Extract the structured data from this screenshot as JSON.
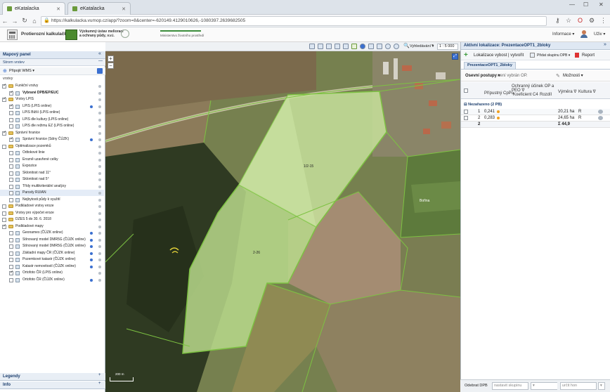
{
  "browser": {
    "tabs": [
      {
        "label": "eKatalacka",
        "active": true
      },
      {
        "label": "eKatalacka",
        "active": false
      }
    ],
    "url": "https://kalkulacka.vumop.cz/app/?zoom=8&center=-620149.4129010626,-1080397.2639682505"
  },
  "header": {
    "app_name": "Protierozní kalkulačka",
    "institute_name_line1": "Výzkumný ústav meliorací",
    "institute_name_line2": "a ochrany půdy, v.v.i.",
    "ministry": "Ministerstvo životního prostředí",
    "user_menu": "Informace ▾",
    "user_name": "Uživ ▾"
  },
  "map_toolbar": {
    "search_label": "Vyhledávání ▾",
    "scale": "1 : 5 000"
  },
  "left_panel": {
    "title": "Mapový panel",
    "subtitle": "Strom vrstev",
    "add_wms": "Připojit WMS ▾",
    "tree_label": "vrstvy",
    "layers": [
      {
        "label": "Funkční vrstvy",
        "type": "folder",
        "checked": true,
        "indent": 0
      },
      {
        "label": "Vybrané DPB/EP/EUC",
        "type": "layer",
        "checked": true,
        "indent": 1,
        "bold": true
      },
      {
        "label": "Vrstvy LPIS",
        "type": "folder",
        "checked": true,
        "indent": 0
      },
      {
        "label": "LPIS (LPIS online)",
        "type": "layer",
        "checked": true,
        "indent": 1,
        "dot": "#3a6fd0"
      },
      {
        "label": "LPIS Bižší (LPIS online)",
        "type": "layer",
        "checked": false,
        "indent": 1
      },
      {
        "label": "LPIS dle kultury (LPIS online)",
        "type": "layer",
        "checked": false,
        "indent": 1
      },
      {
        "label": "LPIS dle režimu EZ (LPIS online)",
        "type": "layer",
        "checked": false,
        "indent": 1
      },
      {
        "label": "Správní hranice",
        "type": "folder",
        "checked": true,
        "indent": 0
      },
      {
        "label": "Správní hranice (Sdny ČÚZK)",
        "type": "layer",
        "checked": true,
        "indent": 1,
        "dot": "#3a6fd0"
      },
      {
        "label": "Optimalizace pozemků",
        "type": "folder",
        "checked": false,
        "indent": 0
      },
      {
        "label": "Odtokové linie",
        "type": "layer",
        "checked": false,
        "indent": 1
      },
      {
        "label": "Erozně uzavřené celky",
        "type": "layer",
        "checked": false,
        "indent": 1
      },
      {
        "label": "Expozice",
        "type": "layer",
        "checked": false,
        "indent": 1
      },
      {
        "label": "Sklonitost nad 11°",
        "type": "layer",
        "checked": false,
        "indent": 1
      },
      {
        "label": "Sklonitost nad 5°",
        "type": "layer",
        "checked": false,
        "indent": 1
      },
      {
        "label": "Třídy multikriteriální analýzy",
        "type": "layer",
        "checked": false,
        "indent": 1
      },
      {
        "label": "Parcely RUIAN",
        "type": "layer",
        "checked": false,
        "indent": 1,
        "highlight": true
      },
      {
        "label": "Nejbytosti půdy k využití",
        "type": "layer",
        "checked": false,
        "indent": 1
      },
      {
        "label": "Podkladové vrstvy eroze",
        "type": "folder",
        "checked": false,
        "indent": 0
      },
      {
        "label": "Vrstvy pro výpočet eroze",
        "type": "folder",
        "checked": false,
        "indent": 0
      },
      {
        "label": "DZES 5 do 30. 6. 2018",
        "type": "folder",
        "checked": false,
        "indent": 0
      },
      {
        "label": "Podkladové mapy",
        "type": "folder",
        "checked": true,
        "indent": 0
      },
      {
        "label": "Geonames (ČÚZK online)",
        "type": "layer",
        "checked": false,
        "indent": 1,
        "dot": "#3a6fd0"
      },
      {
        "label": "Stínovaný model DMR5G (ČÚZK online)",
        "type": "layer",
        "checked": false,
        "indent": 1,
        "dot": "#3a6fd0"
      },
      {
        "label": "Stínovaný model DMR5G (ČÚZK online)",
        "type": "layer",
        "checked": false,
        "indent": 1,
        "dot": "#3a6fd0"
      },
      {
        "label": "Základní mapy ČR (ČÚZK online)",
        "type": "layer",
        "checked": false,
        "indent": 1,
        "dot": "#3a6fd0"
      },
      {
        "label": "Pozemkové katastr (ČÚZK online)",
        "type": "layer",
        "checked": false,
        "indent": 1,
        "dot": "#3a6fd0"
      },
      {
        "label": "Katastr nemovitostí (ČÚZK online)",
        "type": "layer",
        "checked": false,
        "indent": 1,
        "dot": "#3a6fd0"
      },
      {
        "label": "Ortofoto ČR (LPIS online)",
        "type": "layer",
        "checked": true,
        "indent": 1
      },
      {
        "label": "Ortofoto ČR (ČÚZK online)",
        "type": "layer",
        "checked": false,
        "indent": 1,
        "dot": "#3a6fd0"
      }
    ],
    "legend_label": "Legendy",
    "info_label": "Info"
  },
  "map": {
    "labels": [
      {
        "text": "1/2-15"
      },
      {
        "text": "2-26"
      },
      {
        "text": "Bořina"
      }
    ],
    "scalebar": "200 m"
  },
  "right_panel": {
    "title": "Aktivní lokalizace: PrezentaceOPT1_2bloky",
    "add_button": "Lokalizace vybost | vytvořit",
    "add_group_button": "Přidat skupinu DPB ▾",
    "report_button": "Report",
    "tab_label": "PrezentaceOPT1_2bloky",
    "method_label": "Osevní postupy ▾",
    "method_note": "není vybrán OP.",
    "columns_button": "Možnosti ▾",
    "columns": [
      "",
      "Přípustný CpPo",
      "Ochranný účinek OP a PEO ∇",
      "Rozdíl",
      "Výměra ∇",
      "Kultura ∇"
    ],
    "sub_columns": [
      "Koeficient C4"
    ],
    "group_label": "Nezařazeno (2 PB)",
    "rows": [
      {
        "n": "1",
        "cp": "0,241",
        "area": "20,21 ha",
        "kultura": "R"
      },
      {
        "n": "2",
        "cp": "0,283",
        "area": "24,65 ha",
        "kultura": "R"
      }
    ],
    "total_count": "2",
    "total_area": "Σ 44,9"
  },
  "bottom_bar": {
    "label": "Odebrat DPB",
    "group_placeholder": "nastavit skupinu",
    "class_placeholder": "určit hon"
  }
}
